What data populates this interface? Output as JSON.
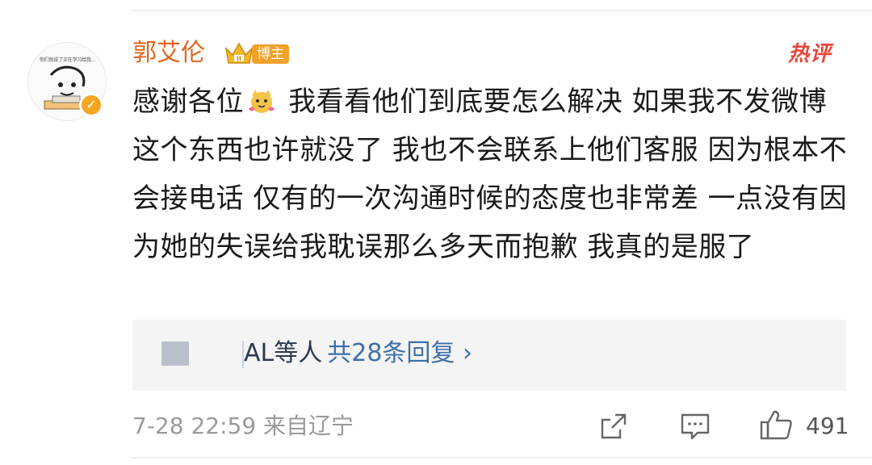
{
  "comment": {
    "username": "郭艾伦",
    "badge": "博主",
    "hot_tag": "热评",
    "avatar_caption": "你们别说了正在学习给我...",
    "text_before_emoji": "感谢各位",
    "text_after_emoji": " 我看看他们到底要怎么解决 如果我不发微博 这个东西也许就没了 我也不会联系上他们客服 因为根本不会接电话 仅有的一次沟通时候的态度也非常差 一点没有因为她的失误给我耽误那么多天而抱歉 我真的是服了"
  },
  "reply_preview": {
    "names": "AL等人",
    "link": "共28条回复 ›"
  },
  "footer": {
    "timestamp": "7-28 22:59 来自辽宁",
    "like_count": "491"
  },
  "colors": {
    "username": "#e0651d",
    "badge": "#f0a22a",
    "hot_tag": "#e8473a",
    "link": "#3c6fa8",
    "meta": "#9a9a9a"
  },
  "icons": [
    "avatar",
    "verified-icon",
    "crown-icon",
    "emoji-icon",
    "share-icon",
    "comment-icon",
    "like-icon"
  ]
}
